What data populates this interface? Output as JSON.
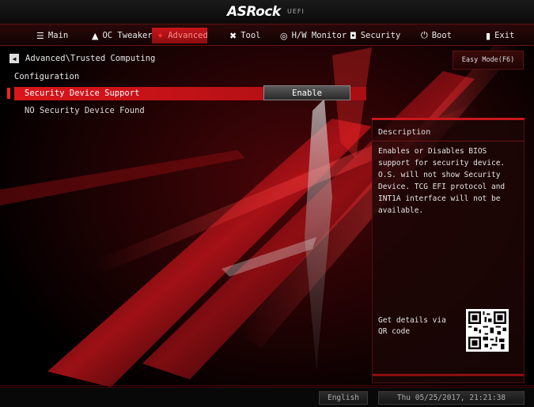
{
  "header": {
    "brand": "ASRock",
    "subtitle": "UEFI"
  },
  "menu": [
    {
      "label": "Main",
      "icon": "list-icon",
      "glyph": "☰",
      "active": false
    },
    {
      "label": "OC Tweaker",
      "icon": "rocket-icon",
      "glyph": "▲",
      "active": false
    },
    {
      "label": "Advanced",
      "icon": "star-icon",
      "glyph": "✦",
      "active": true
    },
    {
      "label": "Tool",
      "icon": "tools-icon",
      "glyph": "✖",
      "active": false
    },
    {
      "label": "H/W Monitor",
      "icon": "monitor-icon",
      "glyph": "◎",
      "active": false
    },
    {
      "label": "Security",
      "icon": "shield-icon",
      "glyph": "◘",
      "active": false
    },
    {
      "label": "Boot",
      "icon": "power-icon",
      "glyph": "⏻",
      "active": false
    },
    {
      "label": "Exit",
      "icon": "exit-icon",
      "glyph": "▮",
      "active": false
    }
  ],
  "breadcrumb": {
    "path": "Advanced\\Trusted Computing"
  },
  "easy_mode": {
    "label": "Easy Mode(F6)"
  },
  "config": {
    "section_title": "Configuration",
    "option": {
      "label": "Security Device Support",
      "value": "Enable"
    },
    "info": "NO Security Device Found"
  },
  "description": {
    "title": "Description",
    "body": "Enables or Disables BIOS support for security device. O.S. will not show Security Device. TCG EFI protocol and INT1A interface will not be available.",
    "qr_text": "Get details via QR code"
  },
  "footer": {
    "language": "English",
    "datetime": "Thu 05/25/2017, 21:21:38"
  },
  "colors": {
    "accent": "#d8161c",
    "panel": "#1c0606"
  }
}
